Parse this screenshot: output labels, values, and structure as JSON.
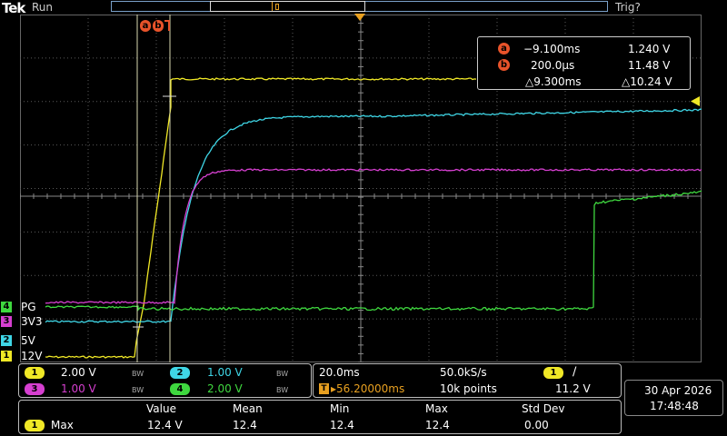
{
  "header": {
    "brand": "Tek",
    "acq_state": "Run",
    "trigger_state": "Trig?"
  },
  "colors": {
    "ch1": "#f0e826",
    "ch2": "#3fd6e6",
    "ch3": "#d63fd0",
    "ch4": "#3fd83f",
    "cursor": "#e8532a",
    "grid": "#5a5a5a"
  },
  "channels": [
    {
      "num": "1",
      "name": "12V",
      "scale": "2.00 V",
      "bw": "BW"
    },
    {
      "num": "2",
      "name": "5V",
      "scale": "1.00 V",
      "bw": "BW"
    },
    {
      "num": "3",
      "name": "3V3",
      "scale": "1.00 V",
      "bw": "BW"
    },
    {
      "num": "4",
      "name": "PG",
      "scale": "2.00 V",
      "bw": "BW"
    }
  ],
  "cursors": {
    "a_label": "a",
    "b_label": "b",
    "a_time": "−9.100ms",
    "a_volt": "1.240 V",
    "b_time": "200.0μs",
    "b_volt": "11.48 V",
    "delta_time": "△9.300ms",
    "delta_volt": "△10.24 V"
  },
  "horizontal": {
    "time_div": "20.0ms",
    "sample_rate": "50.0kS/s",
    "trigger_delay": "▸56.20000ms",
    "record_length": "10k points",
    "trigger_source": "1",
    "trigger_slope": "∕",
    "trigger_level": "11.2 V"
  },
  "datetime": {
    "date": "30 Apr  2026",
    "time": "17:48:48"
  },
  "measurements": {
    "headers": [
      "Value",
      "Mean",
      "Min",
      "Max",
      "Std Dev"
    ],
    "source": "1",
    "name": "Max",
    "values": [
      "12.4 V",
      "12.4",
      "12.4",
      "12.4",
      "0.00"
    ]
  }
}
